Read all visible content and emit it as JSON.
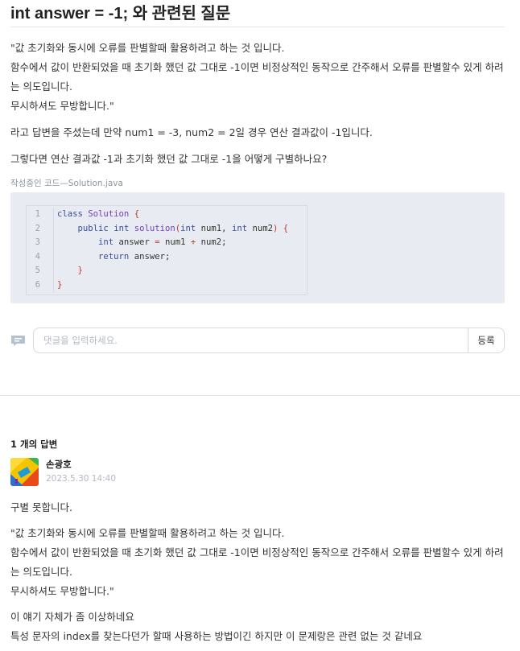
{
  "question": {
    "title": "int answer = -1; 와 관련된 질문",
    "quote_lines": [
      "\"값 초기화와 동시에 오류를 판별할때 활용하려고 하는 것 입니다.",
      "함수에서 값이 반환되었을 때 초기화 했던 값 그대로 -1이면 비정상적인 동작으로 간주해서 오류를 판별할수 있게 하려",
      "는 의도입니다.",
      "무시하셔도 무방합니다.\""
    ],
    "line2": "라고 답변을 주셨는데 만약 num1 = -3, num2 = 2일 경우 연산 결과값이 -1입니다.",
    "line3": "그렇다면 연산 결과값 -1과 초기화 했던 값 그대로 -1을 어떻게 구별하나요?",
    "code_caption": "작성중인 코드—Solution.java",
    "code_numbers": [
      "1",
      "2",
      "3",
      "4",
      "5",
      "6"
    ]
  },
  "comment": {
    "placeholder": "댓글을 입력하세요.",
    "submit_label": "등록"
  },
  "answers": {
    "count_label": "1 개의 답변",
    "items": [
      {
        "author": "손광호",
        "date": "2023.5.30 14:40",
        "line1": "구별 못합니다.",
        "quote_lines": [
          "\"값 초기화와 동시에 오류를 판별할때 활용하려고 하는 것 입니다.",
          "함수에서 값이 반환되었을 때 초기화 했던 값 그대로 -1이면 비정상적인 동작으로 간주해서 오류를 판별할수 있게 하려",
          "는 의도입니다.",
          "무시하셔도 무방합니다.\""
        ],
        "tail_lines": [
          "이 얘기 자체가 좀 이상하네요",
          "특성 문자의 index를 찾는다던가 할때 사용하는 방법이긴 하지만 이 문제랑은 관련 없는 것 같네요"
        ]
      }
    ]
  },
  "colors": {
    "accent_bracket": "#c0392b",
    "keyword": "#3a4d9a",
    "code_bg": "#e8ebf1",
    "muted": "#b3b9c2"
  }
}
